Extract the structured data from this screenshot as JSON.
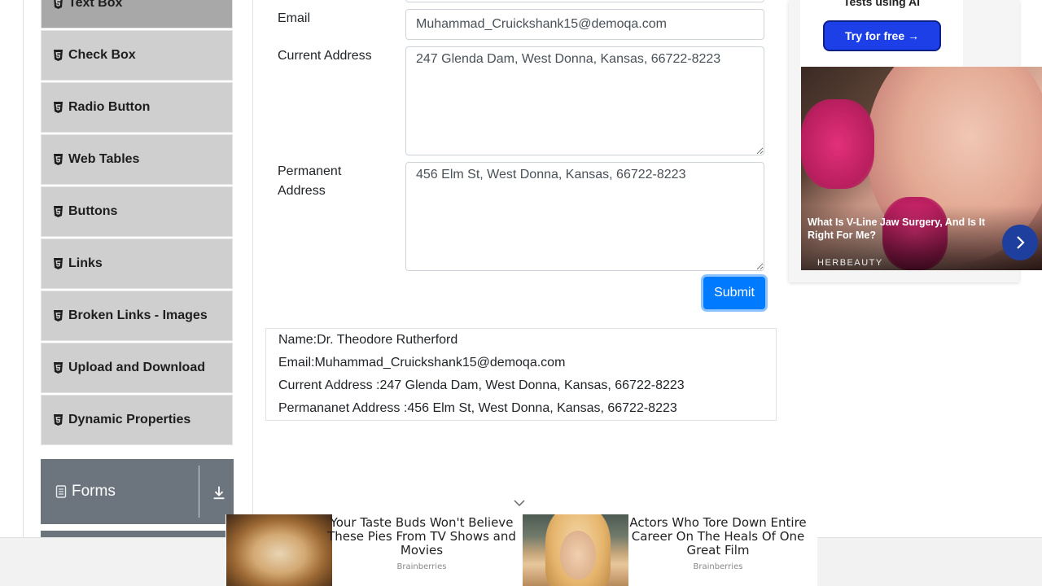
{
  "sidebar": {
    "items": [
      {
        "label": "Text Box",
        "icon": "html5-icon"
      },
      {
        "label": "Check Box",
        "icon": "html5-icon"
      },
      {
        "label": "Radio Button",
        "icon": "html5-icon"
      },
      {
        "label": "Web Tables",
        "icon": "html5-icon"
      },
      {
        "label": "Buttons",
        "icon": "html5-icon"
      },
      {
        "label": "Links",
        "icon": "html5-icon"
      },
      {
        "label": "Broken Links - Images",
        "icon": "html5-icon"
      },
      {
        "label": "Upload and Download",
        "icon": "html5-icon"
      },
      {
        "label": "Dynamic Properties",
        "icon": "html5-icon"
      }
    ],
    "active_item": "Text Box",
    "forms_group": {
      "label": "Forms",
      "icon": "document-icon",
      "toggle_icon": "download-arrow-icon"
    }
  },
  "form": {
    "email_label": "Email",
    "email_value": "Muhammad_Cruickshank15@demoqa.com",
    "current_address_label": "Current Address",
    "current_address_value": "247 Glenda Dam, West Donna, Kansas, 66722-8223",
    "permanent_address_label_line1": "Permanent",
    "permanent_address_label_line2": "Address",
    "permanent_address_value": "456 Elm St, West Donna, Kansas, 66722-8223",
    "submit_label": "Submit"
  },
  "output": {
    "name": "Name:Dr. Theodore Rutherford",
    "email": "Email:Muhammad_Cruickshank15@demoqa.com",
    "current_address": "Current Address :247 Glenda Dam, West Donna, Kansas, 66722-8223",
    "permanent_address": "Permananet Address :456 Elm St, West Donna, Kansas, 66722-8223"
  },
  "ad_right": {
    "top_text": "Tests using AI",
    "try_label": "Try for free →",
    "caption": "What Is V-Line Jaw Surgery, And Is It Right For Me?",
    "brand": "HERBEAUTY"
  },
  "bottom_ad": {
    "items": [
      {
        "title": "Your Taste Buds Won't Believe These Pies From TV Shows and Movies",
        "source": "Brainberries"
      },
      {
        "title": "Actors Who Tore Down Entire Career On The Heals Of One Great Film",
        "source": "Brainberries"
      }
    ]
  },
  "colors": {
    "accent": "#007bff",
    "sidebar_bg": "#cfcfcf",
    "sidebar_active": "#a8a8a8",
    "group_header": "#6c757d"
  }
}
